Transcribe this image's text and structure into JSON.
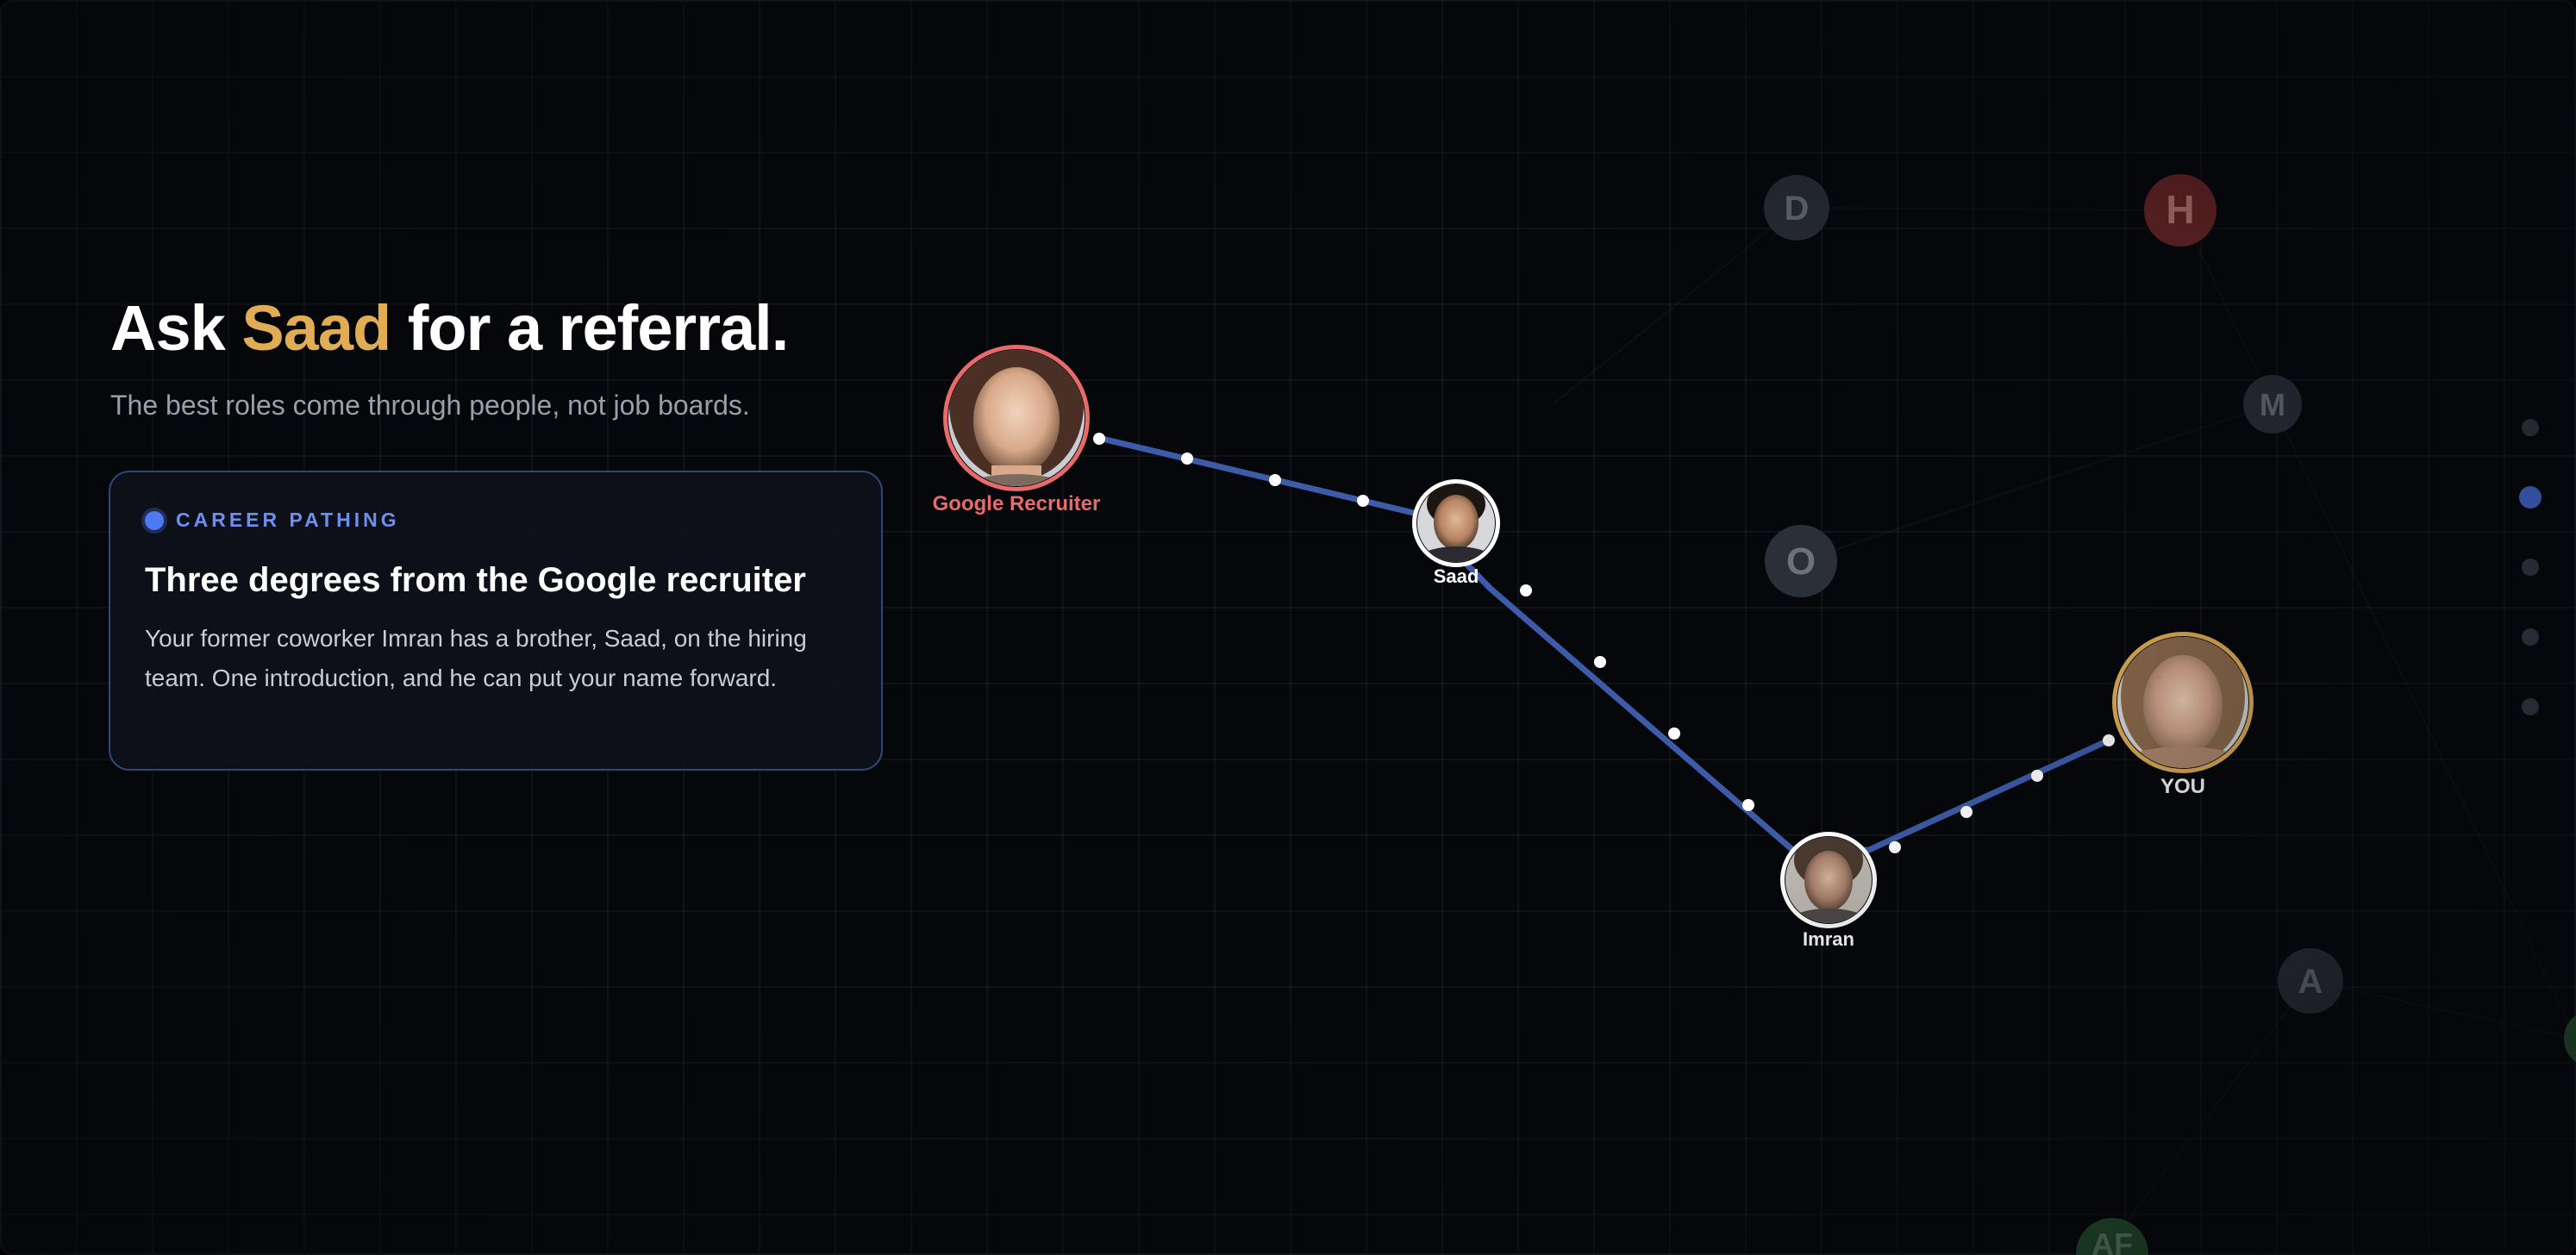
{
  "hero": {
    "title_prefix": "Ask ",
    "title_highlight": "Saad",
    "title_suffix": " for a referral.",
    "subtitle": "The best roles come through people, not job boards."
  },
  "card": {
    "tag": "CAREER PATHING",
    "title": "Three degrees from the Google recruiter",
    "body": "Your former coworker Imran has a brother, Saad, on the hiring team. One introduction, and he can put your name forward."
  },
  "path_nodes": {
    "recruiter": "Google Recruiter",
    "saad": "Saad",
    "imran": "Imran",
    "you": "YOU"
  },
  "background_nodes": {
    "d": "D",
    "h": "H",
    "m": "M",
    "o": "O",
    "a": "A",
    "af": "AF"
  },
  "colors": {
    "highlight": "#e0ad55",
    "accent_blue": "#4f79f2",
    "path_line": "#3d5ba8",
    "recruiter_ring": "#e86a6a",
    "you_ring": "#e0ad55",
    "node_h": "#7a2a2a",
    "node_af": "#2f6b3a"
  },
  "pager": {
    "total": 5,
    "active_index": 1
  }
}
